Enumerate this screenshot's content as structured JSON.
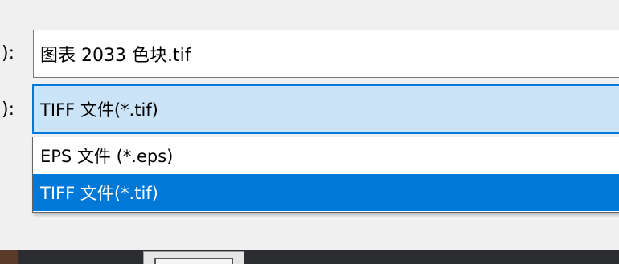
{
  "file_name_row": {
    "label_fragment": "):",
    "value": "图表 2033 色块.tif"
  },
  "file_type_row": {
    "label_fragment": "):",
    "selected_value": "TIFF 文件(*.tif)"
  },
  "file_type_dropdown": {
    "options": [
      {
        "label": "EPS 文件 (*.eps)"
      },
      {
        "label": "TIFF 文件(*.tif)"
      }
    ],
    "selected_index": 1
  },
  "colors": {
    "accent": "#0078d7",
    "select_bg": "#cce4f7",
    "dialog_bg": "#f0f0f0"
  }
}
